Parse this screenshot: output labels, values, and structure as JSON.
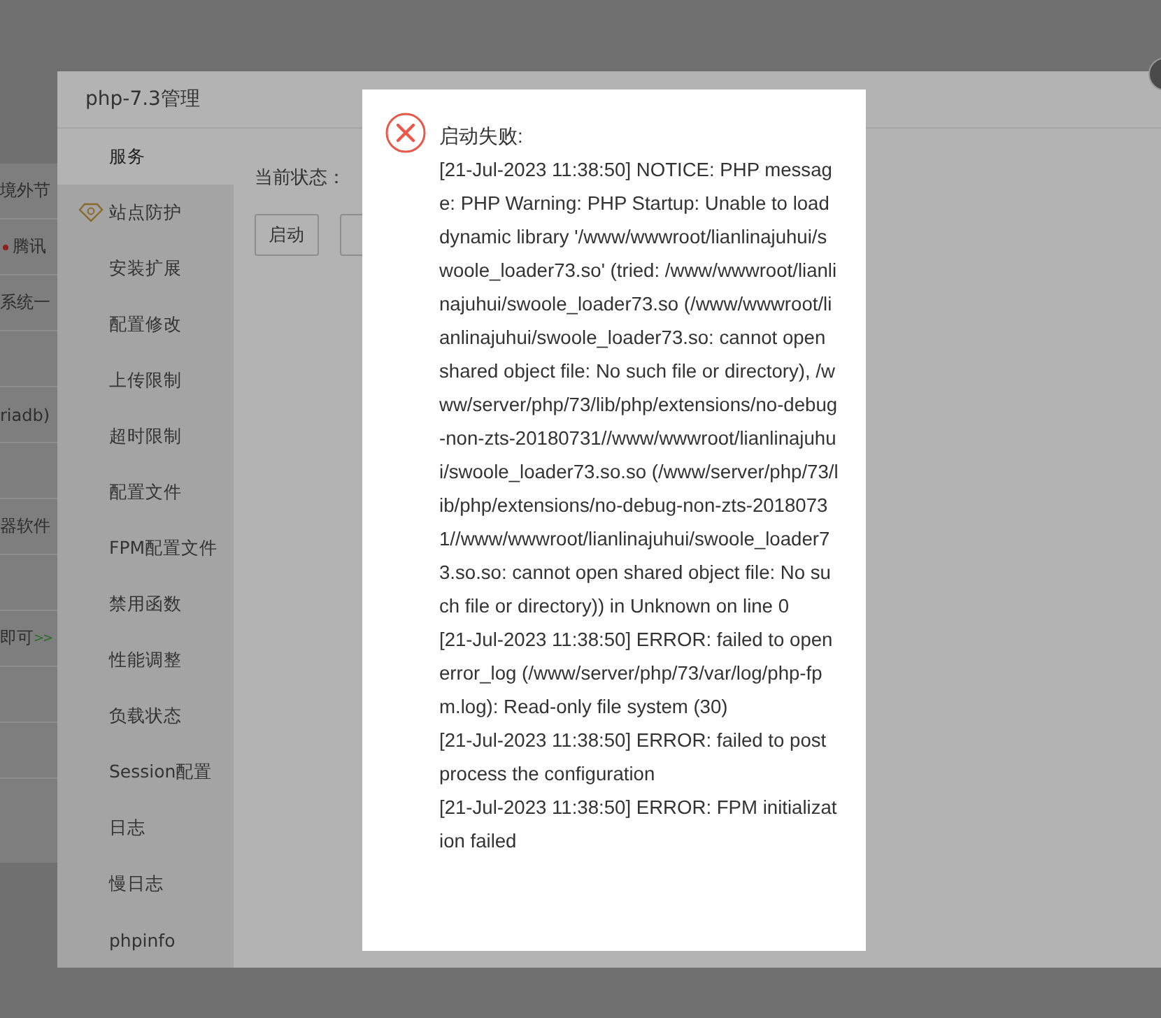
{
  "background_page": {
    "rows": [
      {
        "kind": "text",
        "text": "境外节"
      },
      {
        "kind": "dot",
        "text": "腾讯"
      },
      {
        "kind": "text",
        "text": "系统一"
      },
      {
        "kind": "blank"
      },
      {
        "kind": "text",
        "text": "riadb)"
      },
      {
        "kind": "blank"
      },
      {
        "kind": "text",
        "text": "器软件"
      },
      {
        "kind": "blank"
      },
      {
        "kind": "link",
        "text": "即可",
        "suffix": ">>"
      },
      {
        "kind": "blank"
      },
      {
        "kind": "blank"
      },
      {
        "kind": "blank"
      }
    ]
  },
  "dialog": {
    "title": "php-7.3管理",
    "menu": [
      {
        "label": "服务",
        "selected": true,
        "kind": "plain"
      },
      {
        "label": "站点防护",
        "selected": false,
        "kind": "pro"
      },
      {
        "label": "安装扩展",
        "selected": false,
        "kind": "plain"
      },
      {
        "label": "配置修改",
        "selected": false,
        "kind": "plain"
      },
      {
        "label": "上传限制",
        "selected": false,
        "kind": "plain"
      },
      {
        "label": "超时限制",
        "selected": false,
        "kind": "plain"
      },
      {
        "label": "配置文件",
        "selected": false,
        "kind": "plain"
      },
      {
        "label": "FPM配置文件",
        "selected": false,
        "kind": "plain"
      },
      {
        "label": "禁用函数",
        "selected": false,
        "kind": "plain"
      },
      {
        "label": "性能调整",
        "selected": false,
        "kind": "plain"
      },
      {
        "label": "负载状态",
        "selected": false,
        "kind": "plain"
      },
      {
        "label": "Session配置",
        "selected": false,
        "kind": "plain"
      },
      {
        "label": "日志",
        "selected": false,
        "kind": "plain"
      },
      {
        "label": "慢日志",
        "selected": false,
        "kind": "plain"
      },
      {
        "label": "phpinfo",
        "selected": false,
        "kind": "plain"
      }
    ],
    "status_label": "当前状态：",
    "buttons": [
      "启动"
    ]
  },
  "alert": {
    "kind": "error",
    "title": "启动失败:",
    "lines": [
      "[21-Jul-2023 11:38:50] NOTICE: PHP message: PHP Warning: PHP Startup: Unable to load dynamic library '/www/wwwroot/lianlinajuhui/swoole_loader73.so' (tried: /www/wwwroot/lianlinajuhui/swoole_loader73.so (/www/wwwroot/lianlinajuhui/swoole_loader73.so: cannot open shared object file: No such file or directory), /www/server/php/73/lib/php/extensions/no-debug-non-zts-20180731//www/wwwroot/lianlinajuhui/swoole_loader73.so.so (/www/server/php/73/lib/php/extensions/no-debug-non-zts-20180731//www/wwwroot/lianlinajuhui/swoole_loader73.so.so: cannot open shared object file: No such file or directory)) in Unknown on line 0",
      "[21-Jul-2023 11:38:50] ERROR: failed to open error_log (/www/server/php/73/var/log/php-fpm.log): Read-only file system (30)",
      "[21-Jul-2023 11:38:50] ERROR: failed to post process the configuration",
      "[21-Jul-2023 11:38:50] ERROR: FPM initialization failed"
    ]
  }
}
